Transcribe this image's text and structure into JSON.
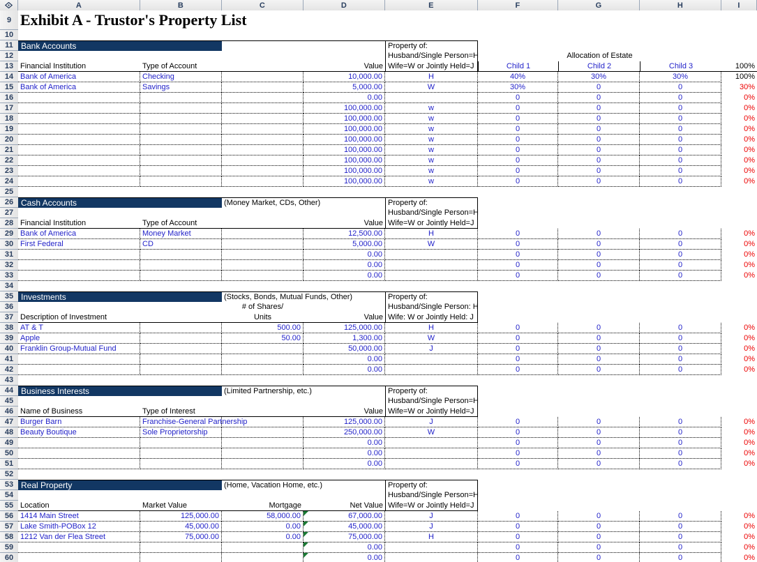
{
  "app": {
    "type": "spreadsheet",
    "corner_icon": "select-all-icon"
  },
  "columns": [
    "A",
    "B",
    "C",
    "D",
    "E",
    "F",
    "G",
    "H",
    "I"
  ],
  "row_numbers": [
    "9",
    "10",
    "11",
    "12",
    "13",
    "14",
    "15",
    "16",
    "17",
    "18",
    "19",
    "20",
    "21",
    "22",
    "23",
    "24",
    "25",
    "26",
    "27",
    "28",
    "29",
    "30",
    "31",
    "32",
    "33",
    "34",
    "35",
    "36",
    "37",
    "38",
    "39",
    "40",
    "41",
    "42",
    "43",
    "44",
    "45",
    "46",
    "47",
    "48",
    "49",
    "50",
    "51",
    "52",
    "53",
    "54",
    "55",
    "56",
    "57",
    "58",
    "59",
    "60"
  ],
  "colors": {
    "banner_navy": "#123763",
    "value_blue": "#1f1fc8",
    "alert_red": "#ec0000",
    "header_grey": "#ebebeb",
    "comment_green": "#1a7a34"
  },
  "title": "Exhibit A - Trustor's Property List",
  "allocation_header": {
    "label": "Allocation of Estate",
    "children": [
      "Child 1",
      "Child 2",
      "Child 3"
    ],
    "total": "100%"
  },
  "property_of_block": {
    "line1": "Property of:",
    "line2": "Husband/Single Person=H",
    "line3": "Wife=W or Jointly Held=J"
  },
  "property_of_block_colon": {
    "line1": "Property of:",
    "line2": "Husband/Single Person: H",
    "line3": "Wife: W or Jointly Held: J"
  },
  "sections": {
    "bank_accounts": {
      "banner": "Bank Accounts",
      "subtitle": "",
      "headers": {
        "col_a": "Financial Institution",
        "col_b": "Type of Account",
        "col_d": "Value"
      },
      "rows": [
        {
          "row": "14",
          "a": "Bank of America",
          "b": "Checking",
          "d": "10,000.00",
          "e": "H",
          "f": "40%",
          "g": "30%",
          "h": "30%",
          "i": "100%",
          "i_color": "black"
        },
        {
          "row": "15",
          "a": "Bank of America",
          "b": "Savings",
          "d": "5,000.00",
          "e": "W",
          "f": "30%",
          "g": "0",
          "h": "0",
          "i": "30%",
          "i_color": "red"
        },
        {
          "row": "16",
          "a": "",
          "b": "",
          "d": "0.00",
          "e": "",
          "f": "0",
          "g": "0",
          "h": "0",
          "i": "0%",
          "i_color": "red"
        },
        {
          "row": "17",
          "a": "",
          "b": "",
          "d": "100,000.00",
          "e": "w",
          "f": "0",
          "g": "0",
          "h": "0",
          "i": "0%",
          "i_color": "red"
        },
        {
          "row": "18",
          "a": "",
          "b": "",
          "d": "100,000.00",
          "e": "w",
          "f": "0",
          "g": "0",
          "h": "0",
          "i": "0%",
          "i_color": "red"
        },
        {
          "row": "19",
          "a": "",
          "b": "",
          "d": "100,000.00",
          "e": "w",
          "f": "0",
          "g": "0",
          "h": "0",
          "i": "0%",
          "i_color": "red"
        },
        {
          "row": "20",
          "a": "",
          "b": "",
          "d": "100,000.00",
          "e": "w",
          "f": "0",
          "g": "0",
          "h": "0",
          "i": "0%",
          "i_color": "red"
        },
        {
          "row": "21",
          "a": "",
          "b": "",
          "d": "100,000.00",
          "e": "w",
          "f": "0",
          "g": "0",
          "h": "0",
          "i": "0%",
          "i_color": "red"
        },
        {
          "row": "22",
          "a": "",
          "b": "",
          "d": "100,000.00",
          "e": "w",
          "f": "0",
          "g": "0",
          "h": "0",
          "i": "0%",
          "i_color": "red"
        },
        {
          "row": "23",
          "a": "",
          "b": "",
          "d": "100,000.00",
          "e": "w",
          "f": "0",
          "g": "0",
          "h": "0",
          "i": "0%",
          "i_color": "red"
        },
        {
          "row": "24",
          "a": "",
          "b": "",
          "d": "100,000.00",
          "e": "w",
          "f": "0",
          "g": "0",
          "h": "0",
          "i": "0%",
          "i_color": "red"
        }
      ]
    },
    "cash_accounts": {
      "banner": "Cash Accounts",
      "subtitle": "(Money Market, CDs, Other)",
      "headers": {
        "col_a": "Financial Institution",
        "col_b": "Type of Account",
        "col_d": "Value"
      },
      "rows": [
        {
          "row": "29",
          "a": "Bank of America",
          "b": "Money Market",
          "d": "12,500.00",
          "e": "H",
          "f": "0",
          "g": "0",
          "h": "0",
          "i": "0%",
          "i_color": "red"
        },
        {
          "row": "30",
          "a": "First Federal",
          "b": "CD",
          "d": "5,000.00",
          "e": "W",
          "f": "0",
          "g": "0",
          "h": "0",
          "i": "0%",
          "i_color": "red"
        },
        {
          "row": "31",
          "a": "",
          "b": "",
          "d": "0.00",
          "e": "",
          "f": "0",
          "g": "0",
          "h": "0",
          "i": "0%",
          "i_color": "red"
        },
        {
          "row": "32",
          "a": "",
          "b": "",
          "d": "0.00",
          "e": "",
          "f": "0",
          "g": "0",
          "h": "0",
          "i": "0%",
          "i_color": "red"
        },
        {
          "row": "33",
          "a": "",
          "b": "",
          "d": "0.00",
          "e": "",
          "f": "0",
          "g": "0",
          "h": "0",
          "i": "0%",
          "i_color": "red"
        }
      ]
    },
    "investments": {
      "banner": "Investments",
      "subtitle": "(Stocks, Bonds, Mutual Funds, Other)",
      "headers": {
        "col_a": "Description of Investment",
        "col_c_line1": "# of Shares/",
        "col_c_line2": "Units",
        "col_d": "Value"
      },
      "rows": [
        {
          "row": "38",
          "a": "AT & T",
          "c": "500.00",
          "d": "125,000.00",
          "e": "H",
          "f": "0",
          "g": "0",
          "h": "0",
          "i": "0%",
          "i_color": "red"
        },
        {
          "row": "39",
          "a": "Apple",
          "c": "50.00",
          "d": "1,300.00",
          "e": "W",
          "f": "0",
          "g": "0",
          "h": "0",
          "i": "0%",
          "i_color": "red"
        },
        {
          "row": "40",
          "a": "Franklin Group-Mutual Fund",
          "c": "",
          "d": "50,000.00",
          "e": "J",
          "f": "0",
          "g": "0",
          "h": "0",
          "i": "0%",
          "i_color": "red"
        },
        {
          "row": "41",
          "a": "",
          "c": "",
          "d": "0.00",
          "e": "",
          "f": "0",
          "g": "0",
          "h": "0",
          "i": "0%",
          "i_color": "red"
        },
        {
          "row": "42",
          "a": "",
          "c": "",
          "d": "0.00",
          "e": "",
          "f": "0",
          "g": "0",
          "h": "0",
          "i": "0%",
          "i_color": "red"
        }
      ]
    },
    "business_interests": {
      "banner": "Business Interests",
      "subtitle": "(Limited Partnership, etc.)",
      "headers": {
        "col_a": "Name of Business",
        "col_b": "Type of Interest",
        "col_d": "Value"
      },
      "rows": [
        {
          "row": "47",
          "a": "Burger Barn",
          "b": "Franchise-General Partnership",
          "d": "125,000.00",
          "e": "J",
          "f": "0",
          "g": "0",
          "h": "0",
          "i": "0%",
          "i_color": "red"
        },
        {
          "row": "48",
          "a": "Beauty Boutique",
          "b": "Sole Proprietorship",
          "d": "250,000.00",
          "e": "W",
          "f": "0",
          "g": "0",
          "h": "0",
          "i": "0%",
          "i_color": "red"
        },
        {
          "row": "49",
          "a": "",
          "b": "",
          "d": "0.00",
          "e": "",
          "f": "0",
          "g": "0",
          "h": "0",
          "i": "0%",
          "i_color": "red"
        },
        {
          "row": "50",
          "a": "",
          "b": "",
          "d": "0.00",
          "e": "",
          "f": "0",
          "g": "0",
          "h": "0",
          "i": "0%",
          "i_color": "red"
        },
        {
          "row": "51",
          "a": "",
          "b": "",
          "d": "0.00",
          "e": "",
          "f": "0",
          "g": "0",
          "h": "0",
          "i": "0%",
          "i_color": "red"
        }
      ]
    },
    "real_property": {
      "banner": "Real Property",
      "subtitle": "(Home, Vacation Home, etc.)",
      "headers": {
        "col_a": "Location",
        "col_b": "Market Value",
        "col_c": "Mortgage",
        "col_d": "Net Value"
      },
      "rows": [
        {
          "row": "56",
          "a": "1414 Main Street",
          "b": "125,000.00",
          "c": "58,000.00",
          "d": "67,000.00",
          "comment": true,
          "e": "J",
          "f": "0",
          "g": "0",
          "h": "0",
          "i": "0%",
          "i_color": "red"
        },
        {
          "row": "57",
          "a": "Lake Smith-POBox 12",
          "b": "45,000.00",
          "c": "0.00",
          "d": "45,000.00",
          "comment": true,
          "e": "J",
          "f": "0",
          "g": "0",
          "h": "0",
          "i": "0%",
          "i_color": "red"
        },
        {
          "row": "58",
          "a": "1212 Van der Flea Street",
          "b": "75,000.00",
          "c": "0.00",
          "d": "75,000.00",
          "comment": true,
          "e": "H",
          "f": "0",
          "g": "0",
          "h": "0",
          "i": "0%",
          "i_color": "red"
        },
        {
          "row": "59",
          "a": "",
          "b": "",
          "c": "",
          "d": "0.00",
          "comment": true,
          "e": "",
          "f": "0",
          "g": "0",
          "h": "0",
          "i": "0%",
          "i_color": "red"
        },
        {
          "row": "60",
          "a": "",
          "b": "",
          "c": "",
          "d": "0.00",
          "comment": true,
          "e": "",
          "f": "0",
          "g": "0",
          "h": "0",
          "i": "0%",
          "i_color": "red"
        }
      ]
    }
  }
}
